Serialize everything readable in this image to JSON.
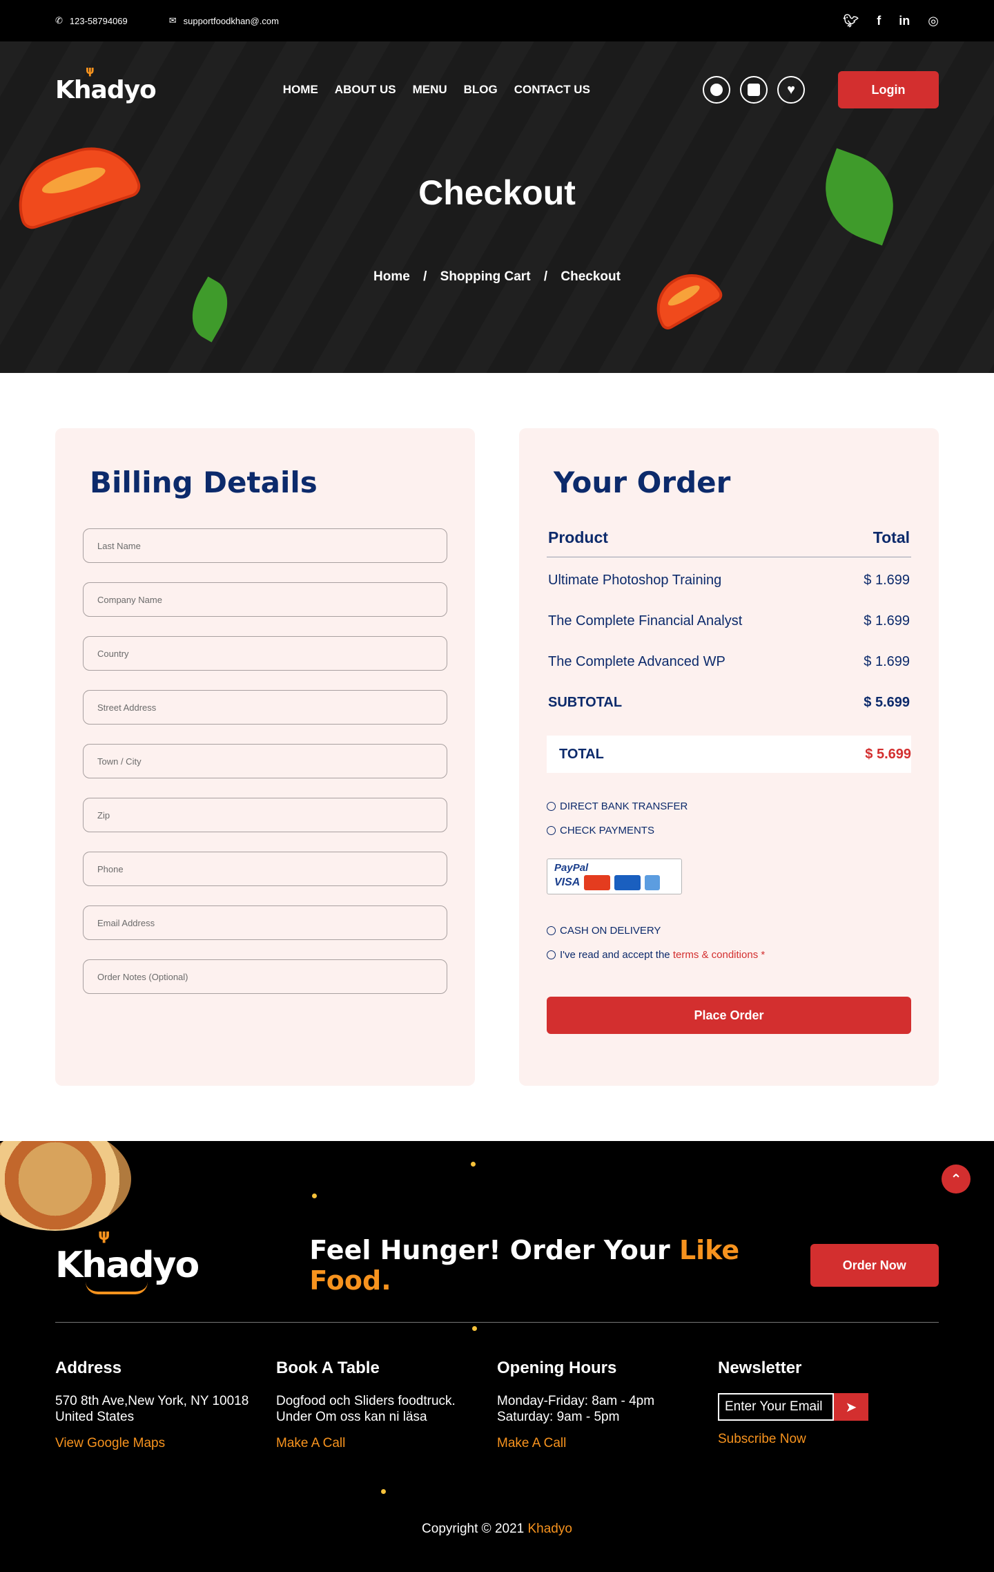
{
  "topbar": {
    "phone": "123-58794069",
    "email": "supportfoodkhan@.com",
    "socials": [
      "twitter-icon",
      "facebook-icon",
      "linkedin-icon",
      "instagram-icon"
    ]
  },
  "nav": {
    "logo": "Khadyo",
    "menu": [
      "HOME",
      "ABOUT US",
      "MENU",
      "BLOG",
      "CONTACT US"
    ],
    "login": "Login"
  },
  "hero": {
    "title": "Checkout",
    "breadcrumb": [
      "Home",
      "Shopping Cart",
      "Checkout"
    ]
  },
  "billing": {
    "title": "Billing Details",
    "fields": [
      "Last Name",
      "Company Name",
      "Country",
      "Street Address",
      "Town / City",
      "Zip",
      "Phone",
      "Email Address",
      "Order Notes (Optional)"
    ]
  },
  "order": {
    "title": "Your Order",
    "head_product": "Product",
    "head_total": "Total",
    "items": [
      {
        "name": "Ultimate Photoshop Training",
        "price": "$ 1.699"
      },
      {
        "name": "The Complete Financial Analyst",
        "price": "$ 1.699"
      },
      {
        "name": "The Complete Advanced WP",
        "price": "$ 1.699"
      }
    ],
    "subtotal_label": "SUBTOTAL",
    "subtotal": "$ 5.699",
    "total_label": "TOTAL",
    "total": "$ 5.699",
    "payment": {
      "direct": "DIRECT BANK TRANSFER",
      "check": "CHECK PAYMENTS",
      "paypal": "PayPal",
      "visa": "VISA",
      "cod": "CASH ON DELIVERY",
      "terms_prefix": "I've read and accept the ",
      "terms_link": "terms & conditions",
      "terms_star": " *"
    },
    "place_order": "Place Order"
  },
  "footer": {
    "logo": "Khadyo",
    "cta_main": "Feel Hunger! Order Your ",
    "cta_highlight": "Like Food.",
    "order_now": "Order Now",
    "cols": [
      {
        "title": "Address",
        "lines": [
          "570 8th Ave,New York, NY 10018",
          "United States"
        ],
        "link": "View Google Maps"
      },
      {
        "title": "Book A Table",
        "lines": [
          "Dogfood och Sliders foodtruck.",
          "Under Om oss kan ni läsa"
        ],
        "link": "Make A Call"
      },
      {
        "title": "Opening Hours",
        "lines": [
          "Monday-Friday: 8am - 4pm",
          "Saturday: 9am - 5pm"
        ],
        "link": "Make A Call"
      }
    ],
    "newsletter": {
      "title": "Newsletter",
      "placeholder": "Enter Your Email",
      "subscribe": "Subscribe Now"
    },
    "copyright": "Copyright",
    "copyright_symbol": "©",
    "year": "2021",
    "brand": "Khadyo"
  },
  "colors": {
    "accent": "#d32f2f",
    "orange": "#f7931e",
    "navy": "#0c2a6b",
    "card": "#fdf1ef"
  }
}
